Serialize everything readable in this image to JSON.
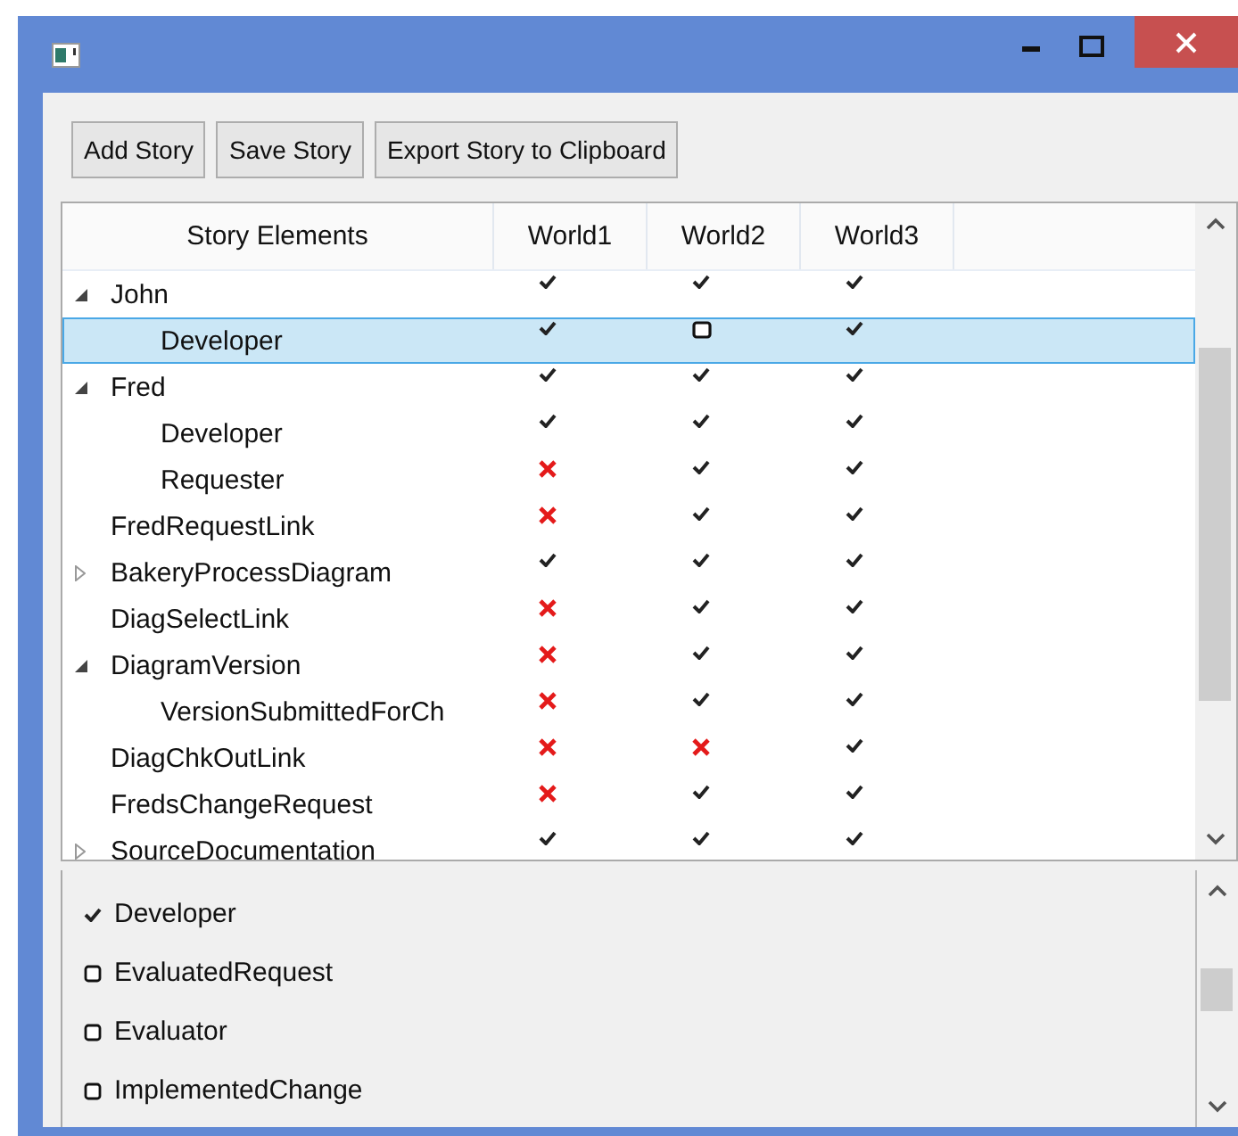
{
  "toolbar": {
    "buttons": [
      "Add Story",
      "Save Story",
      "Export Story to Clipboard"
    ]
  },
  "table": {
    "columns": [
      "Story Elements",
      "World1",
      "World2",
      "World3"
    ],
    "rows": [
      {
        "label": "John",
        "expanded": true,
        "selected": false,
        "cells": [
          {
            "kind": "check"
          },
          {
            "kind": "check"
          },
          {
            "kind": "check"
          }
        ],
        "children": [
          {
            "label": "Developer",
            "selected": true,
            "cells": [
              {
                "kind": "check"
              },
              {
                "kind": "box"
              },
              {
                "kind": "check"
              }
            ]
          }
        ]
      },
      {
        "label": "Fred",
        "expanded": true,
        "selected": false,
        "cells": [
          {
            "kind": "check"
          },
          {
            "kind": "check"
          },
          {
            "kind": "check"
          }
        ],
        "children": [
          {
            "label": "Developer",
            "selected": false,
            "cells": [
              {
                "kind": "check"
              },
              {
                "kind": "check"
              },
              {
                "kind": "check"
              }
            ]
          },
          {
            "label": "Requester",
            "selected": false,
            "cells": [
              {
                "kind": "cross"
              },
              {
                "kind": "check"
              },
              {
                "kind": "check"
              }
            ]
          }
        ]
      },
      {
        "label": "FredRequestLink",
        "selected": false,
        "cells": [
          {
            "kind": "cross"
          },
          {
            "kind": "check"
          },
          {
            "kind": "check"
          }
        ]
      },
      {
        "label": "BakeryProcessDiagram",
        "expanded": false,
        "selected": false,
        "cells": [
          {
            "kind": "check"
          },
          {
            "kind": "check"
          },
          {
            "kind": "check"
          }
        ]
      },
      {
        "label": "DiagSelectLink",
        "selected": false,
        "cells": [
          {
            "kind": "cross"
          },
          {
            "kind": "check"
          },
          {
            "kind": "check"
          }
        ]
      },
      {
        "label": "DiagramVersion",
        "expanded": true,
        "selected": false,
        "cells": [
          {
            "kind": "cross"
          },
          {
            "kind": "check"
          },
          {
            "kind": "check"
          }
        ],
        "children": [
          {
            "label": "VersionSubmittedForCh",
            "selected": false,
            "cells": [
              {
                "kind": "cross"
              },
              {
                "kind": "check"
              },
              {
                "kind": "check"
              }
            ]
          }
        ]
      },
      {
        "label": "DiagChkOutLink",
        "selected": false,
        "cells": [
          {
            "kind": "cross"
          },
          {
            "kind": "cross"
          },
          {
            "kind": "check"
          }
        ]
      },
      {
        "label": "FredsChangeRequest",
        "selected": false,
        "cells": [
          {
            "kind": "cross"
          },
          {
            "kind": "check"
          },
          {
            "kind": "check"
          }
        ]
      },
      {
        "label": "SourceDocumentation",
        "expanded": false,
        "selected": false,
        "cells": [
          {
            "kind": "check"
          },
          {
            "kind": "check"
          },
          {
            "kind": "check"
          }
        ]
      }
    ]
  },
  "roles": [
    {
      "label": "Developer",
      "checked": true
    },
    {
      "label": "EvaluatedRequest",
      "checked": false
    },
    {
      "label": "Evaluator",
      "checked": false
    },
    {
      "label": "ImplementedChange",
      "checked": false
    }
  ]
}
